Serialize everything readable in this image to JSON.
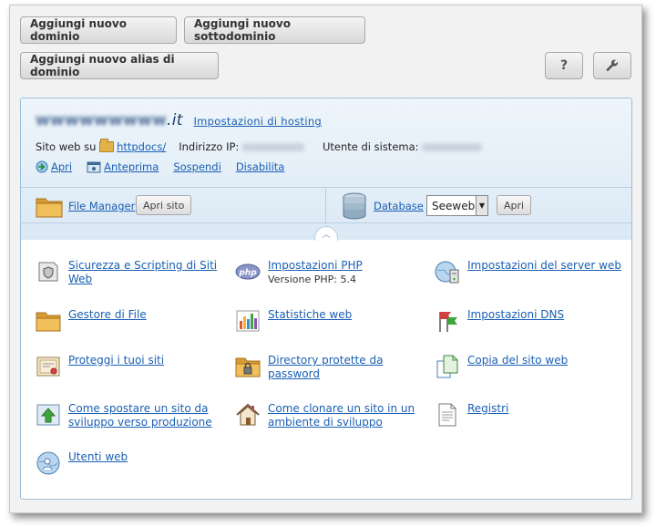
{
  "top_buttons": {
    "add_domain": "Aggiungi nuovo dominio",
    "add_subdomain": "Aggiungi nuovo sottodominio",
    "add_alias": "Aggiungi nuovo alias di dominio",
    "help": "?"
  },
  "domain": {
    "name_prefix": "wwwwwwwww",
    "name_tld": ".it",
    "hosting_settings": "Impostazioni di hosting",
    "website_on": "Sito web su",
    "docroot": "httpdocs/",
    "ip_label": "Indirizzo IP:",
    "user_label": "Utente di sistema:"
  },
  "actions": {
    "open": "Apri",
    "preview": "Anteprima",
    "suspend": "Sospendi",
    "disable": "Disabilita"
  },
  "tools": {
    "file_manager": "File Manager",
    "open_site": "Apri sito",
    "database": "Database",
    "db_select_value": "Seeweb",
    "db_open": "Apri"
  },
  "items": [
    {
      "label": "Sicurezza e Scripting di Siti Web",
      "icon": "shield-icon"
    },
    {
      "label": "Impostazioni PHP",
      "sub": "Versione PHP: 5.4",
      "icon": "php-icon"
    },
    {
      "label": "Impostazioni del server web",
      "icon": "server-icon"
    },
    {
      "label": "Gestore di File",
      "icon": "folder-icon"
    },
    {
      "label": "Statistiche web",
      "icon": "chart-icon"
    },
    {
      "label": "Impostazioni DNS",
      "icon": "dns-flags-icon"
    },
    {
      "label": "Proteggi i tuoi siti",
      "icon": "certificate-icon"
    },
    {
      "label": "Directory protette da password",
      "icon": "locked-folder-icon"
    },
    {
      "label": "Copia del sito web",
      "icon": "copy-icon"
    },
    {
      "label": "Come spostare un sito da sviluppo verso produzione",
      "icon": "upload-icon"
    },
    {
      "label": "Come clonare un sito in un ambiente di sviluppo",
      "icon": "house-icon"
    },
    {
      "label": "Registri",
      "icon": "log-icon"
    },
    {
      "label": "Utenti web",
      "icon": "web-users-icon"
    }
  ]
}
